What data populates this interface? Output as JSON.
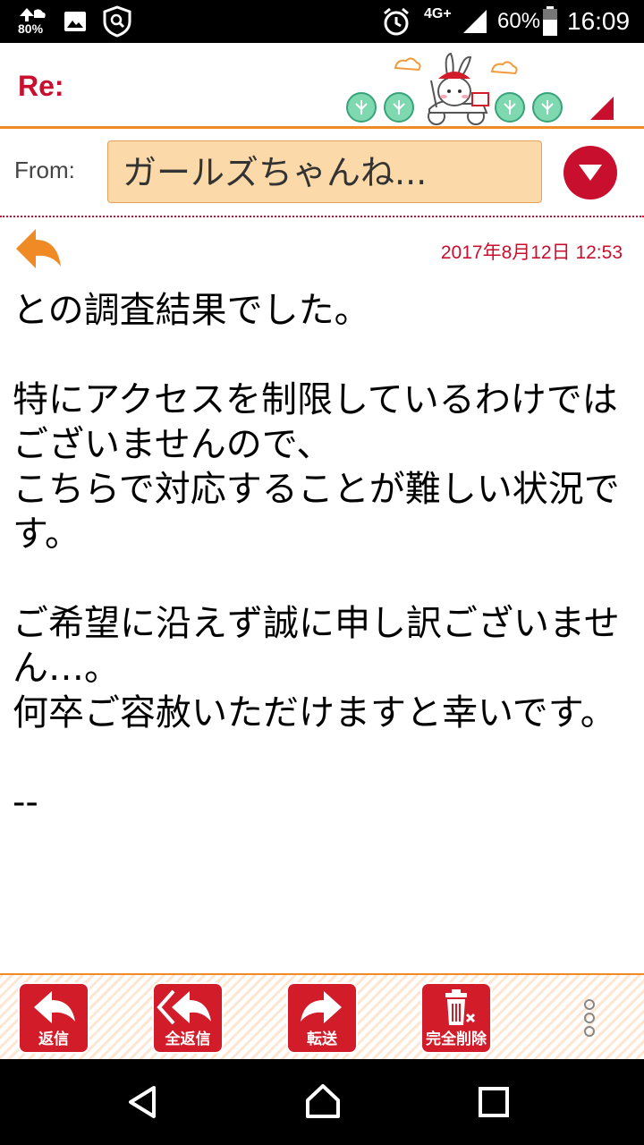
{
  "status_bar": {
    "data_speed": "80%",
    "network": "4G+",
    "battery_percent": "60%",
    "time": "16:09",
    "icons": [
      "data-up-icon",
      "image-icon",
      "shield-search-icon",
      "alarm-icon",
      "signal-icon",
      "battery-icon"
    ]
  },
  "header": {
    "prefix": "Re:"
  },
  "from": {
    "label": "From:",
    "value": "ガールズちゃんね..."
  },
  "message": {
    "date": "2017年8月12日 12:53",
    "paragraphs": [
      "との調査結果でした。",
      "特にアクセスを制限しているわけではございませんので、\nこちらで対応することが難しい状況です。",
      "ご希望に沿えず誠に申し訳ございません…。\n何卒ご容赦いただけますと幸いです。"
    ],
    "signature": "--"
  },
  "toolbar": {
    "reply_label": "返信",
    "reply_all_label": "全返信",
    "forward_label": "転送",
    "delete_label": "完全削除"
  },
  "colors": {
    "accent_red": "#c8102e",
    "accent_orange": "#f08a24",
    "from_box_bg": "#fcd9a8",
    "button_red": "#d21c2a"
  }
}
